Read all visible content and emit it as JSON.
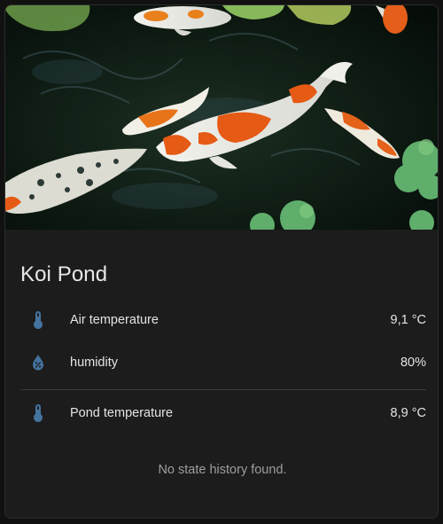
{
  "card": {
    "title": "Koi Pond",
    "image_description_icon": "koi-pond-image"
  },
  "entities": [
    {
      "icon": "thermometer-icon",
      "label": "Air temperature",
      "value": "9,1 °C"
    },
    {
      "icon": "water-percent-icon",
      "label": "humidity",
      "value": "80%"
    },
    {
      "icon": "thermometer-icon",
      "label": "Pond temperature",
      "value": "8,9 °C"
    }
  ],
  "history": {
    "empty_message": "No state history found."
  },
  "colors": {
    "icon_blue": "#44739e",
    "card_bg": "#1c1c1c",
    "text_primary": "#e4e4e4",
    "text_secondary": "#9e9e9e"
  }
}
